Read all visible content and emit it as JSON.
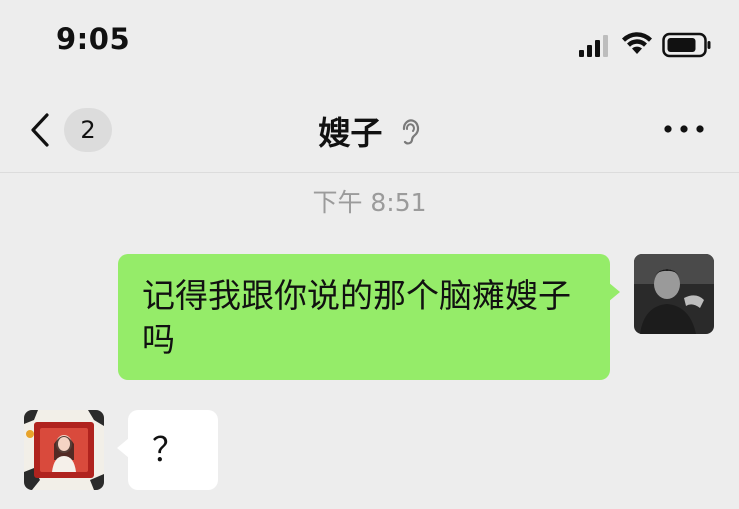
{
  "status_bar": {
    "time": "9:05",
    "icons": [
      "cellular-signal-icon",
      "wifi-icon",
      "battery-icon"
    ]
  },
  "nav": {
    "back_icon": "chevron-left-icon",
    "unread_count": "2",
    "title": "嫂子",
    "muted_icon": "ear-icon",
    "more_icon": "more-dots-icon"
  },
  "chat": {
    "timestamp": "下午 8:51",
    "messages": [
      {
        "direction": "outgoing",
        "text": "记得我跟你说的那个脑瘫嫂子吗",
        "avatar": "self-avatar"
      },
      {
        "direction": "incoming",
        "text": "？",
        "avatar": "contact-avatar"
      }
    ]
  },
  "colors": {
    "background": "#ededed",
    "outgoing_bubble": "#95ec69",
    "incoming_bubble": "#ffffff",
    "timestamp_text": "#9b9b9b",
    "badge_background": "#dcdcdc"
  }
}
